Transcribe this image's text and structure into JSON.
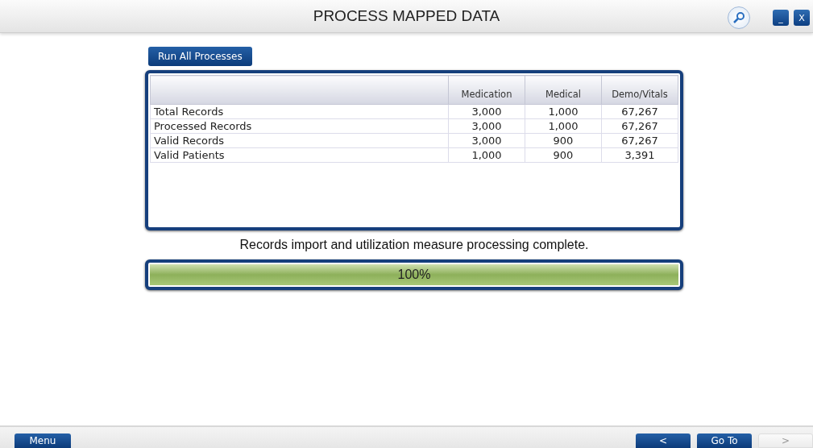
{
  "window": {
    "title": "PROCESS MAPPED DATA",
    "buttons": [
      {
        "kind": "search"
      },
      {
        "kind": "minimize",
        "label": "_"
      },
      {
        "kind": "close",
        "label": "X"
      }
    ]
  },
  "run_button": "Run All Processes",
  "table": {
    "columns": [
      "",
      "Medication",
      "Medical",
      "Demo/Vitals"
    ],
    "rows": [
      [
        "Total Records",
        "3,000",
        "1,000",
        "67,267"
      ],
      [
        "Processed Records",
        "3,000",
        "1,000",
        "67,267"
      ],
      [
        "Valid Records",
        "3,000",
        "900",
        "67,267"
      ],
      [
        "Valid Patients",
        "1,000",
        "900",
        "3,391"
      ]
    ]
  },
  "status_message": "Records import and utilization measure processing complete.",
  "progress": {
    "level": 1,
    "reading": "100%"
  },
  "footer": {
    "menu": {
      "label": "Menu",
      "disabled": false
    },
    "nav": [
      {
        "label": "<",
        "disabled": false
      },
      {
        "label": "Go To",
        "disabled": false
      },
      {
        "label": ">",
        "disabled": true
      }
    ]
  }
}
